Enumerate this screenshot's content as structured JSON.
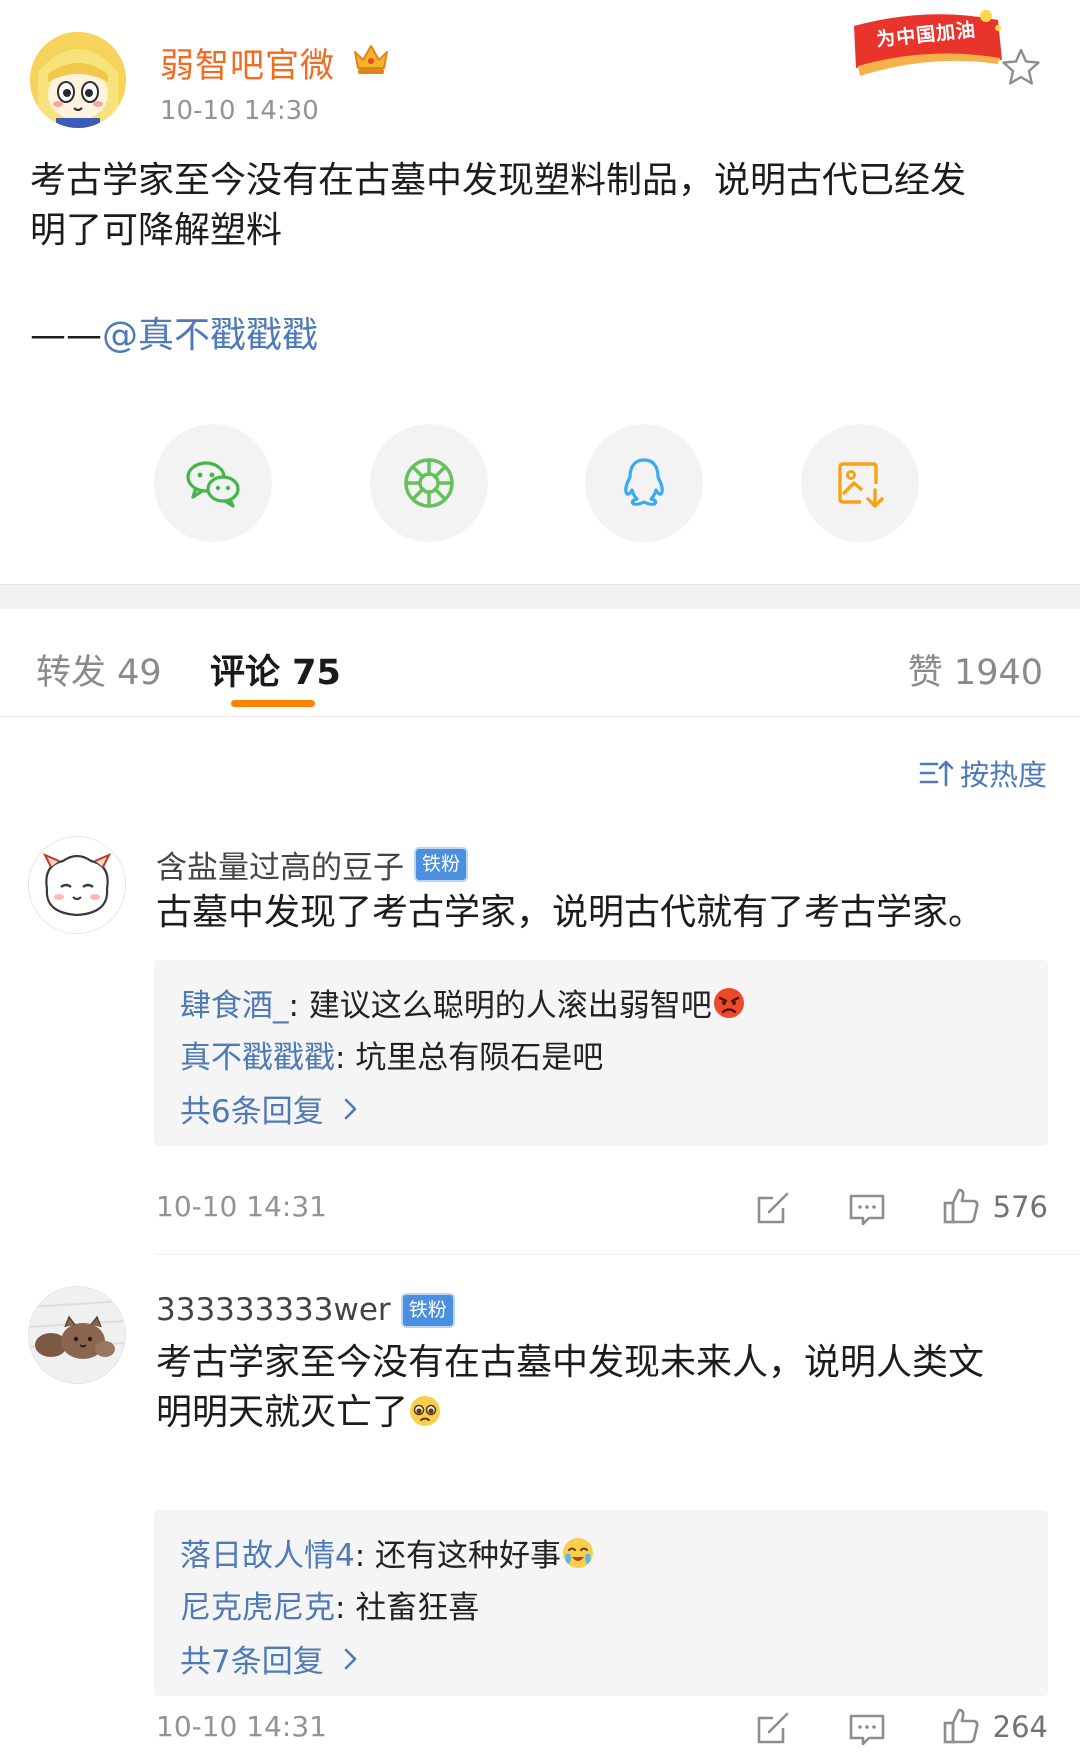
{
  "post": {
    "author": "弱智吧官微",
    "time": "10-10 14:30",
    "campaign_badge": "为中国加油",
    "body_line1": "考古学家至今没有在古墓中发现塑料制品，说明古代已经发",
    "body_line2": "明了可降解塑料",
    "signoff_prefix": "——",
    "signoff_mention": "@真不戳戳戳",
    "share_buttons": [
      "wechat-icon",
      "moments-icon",
      "qq-icon",
      "save-image-icon"
    ],
    "colors": {
      "author": "#f46a1f",
      "link": "#4f7ab8",
      "tab_indicator": "#ff8200",
      "fan_badge": "#4a8fe0"
    }
  },
  "tabs": {
    "repost": "转发 49",
    "comments": "评论 75",
    "likes": "赞 1940",
    "active": "comments"
  },
  "sort": {
    "label": "按热度"
  },
  "comments": [
    {
      "user": "含盐量过高的豆子",
      "badge": "铁粉",
      "text": "古墓中发现了考古学家，说明古代就有了考古学家。",
      "replies": [
        {
          "name": "肆食酒_",
          "sep": ": ",
          "text": "建议这么聪明的人滚出弱智吧",
          "emoji": "angry-face-emoji"
        },
        {
          "name": "真不戳戳戳",
          "sep": ": ",
          "text": "坑里总有陨石是吧"
        }
      ],
      "more_replies": "共6条回复",
      "time": "10-10 14:31",
      "likes": "576"
    },
    {
      "user": "333333333wer",
      "badge": "铁粉",
      "text_line1": "考古学家至今没有在古墓中发现未来人，说明人类文",
      "text_line2": "明明天就灭亡了",
      "text_emoji": "pleading-face-emoji",
      "replies": [
        {
          "name": "落日故人情4",
          "sep": ": ",
          "text": "还有这种好事",
          "emoji": "crying-happy-emoji"
        },
        {
          "name": "尼克虎尼克",
          "sep": ": ",
          "text": "社畜狂喜"
        }
      ],
      "more_replies": "共7条回复",
      "time": "10-10 14:31",
      "likes": "264"
    }
  ]
}
